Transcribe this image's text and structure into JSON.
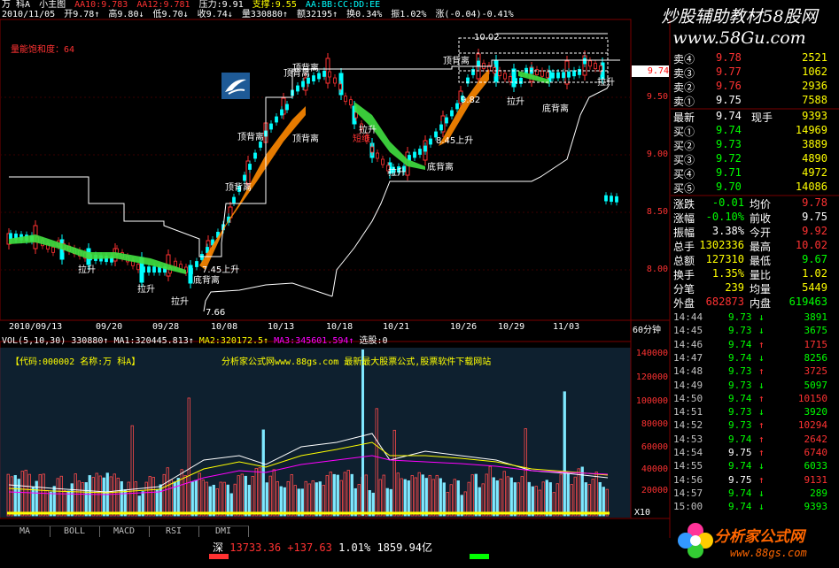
{
  "header": {
    "name": "万  科A",
    "mode": "小主图",
    "aa10": "AA10:9.783",
    "aa12": "AA12:9.781",
    "pressure": "压力:9.91",
    "support": "支撑:9.55",
    "abc": "AA:BB:CC:DD:EE",
    "date": "2010/11/05",
    "open": "开9.78↑",
    "high": "高9.80↓",
    "low": "低9.70↓",
    "close": "收9.74↓",
    "volume": "量330880↑",
    "amount": "额32195↑",
    "turnover": "换0.34%",
    "amplitude": "振1.02%",
    "change": "涨(-0.04)-0.41%"
  },
  "watermark_top": "炒股辅助教材58股网",
  "watermark_top_url": "www.58Gu.com",
  "indicator_label": "量能饱和度：64",
  "annotations": [
    {
      "text": "顶背离",
      "color": "#ffffff"
    },
    {
      "text": "顶背离",
      "color": "#ffffff"
    },
    {
      "text": "顶背离",
      "color": "#ffffff"
    },
    {
      "text": "顶背离",
      "color": "#ffffff"
    },
    {
      "text": "顶背离",
      "color": "#ffffff"
    },
    {
      "text": "顶背离",
      "color": "#ffffff"
    },
    {
      "text": "底背离",
      "color": "#ffffff"
    },
    {
      "text": "底背离",
      "color": "#ffffff"
    },
    {
      "text": "底背离",
      "color": "#ffffff"
    },
    {
      "text": "拉升",
      "color": "#ffffff"
    },
    {
      "text": "拉升",
      "color": "#ffffff"
    },
    {
      "text": "拉升",
      "color": "#ffffff"
    },
    {
      "text": "拉升",
      "color": "#ffffff"
    },
    {
      "text": "拉升",
      "color": "#ffffff"
    },
    {
      "text": "拉升",
      "color": "#ffffff"
    },
    {
      "text": "拉升",
      "color": "#ffffff"
    },
    {
      "text": "短线",
      "color": "#ff3333"
    },
    {
      "text": "7.45上升",
      "color": "#ffffff"
    },
    {
      "text": "8.45上升",
      "color": "#ffffff"
    },
    {
      "text": "7.66",
      "color": "#ffffff"
    },
    {
      "text": "10.02",
      "color": "#ffffff"
    },
    {
      "text": "9.82",
      "color": "#ffffff"
    }
  ],
  "price_axis": [
    "9.50",
    "9.00",
    "8.50",
    "8.00"
  ],
  "price_tag": "9.74",
  "date_axis": [
    "2010/09/13",
    "09/20",
    "09/28",
    "10/08",
    "10/13",
    "10/18",
    "10/21",
    "10/26",
    "10/29",
    "11/03"
  ],
  "period": "60分钟",
  "vol_header": {
    "vol": "VOL(5,10,30) 330880↑",
    "ma1": "MA1:320445.813↑",
    "ma2": "MA2:320172.5↑",
    "ma3": "MA3:345601.594↑",
    "stock_pick": "选股:0"
  },
  "info_panel": {
    "code": "【代码:000002 名称:万  科A】",
    "ad": "分析家公式网www.88gs.com 最新最大股票公式,股票软件下载网站"
  },
  "vol_axis": [
    "140000",
    "120000",
    "100000",
    "80000",
    "60000",
    "40000",
    "20000"
  ],
  "vol_unit": "X10",
  "tabs": [
    "MA",
    "BOLL",
    "MACD",
    "RSI",
    "DMI"
  ],
  "status": {
    "index": "深",
    "value": "13733.36",
    "change": "+137.63",
    "pct": "1.01%",
    "amount": "1859.94亿"
  },
  "watermark_bottom": "分析家公式网",
  "watermark_bottom_url": "www.88gs.com",
  "orderbook": {
    "sells": [
      {
        "label": "卖④",
        "price": "9.78",
        "qty": "2521"
      },
      {
        "label": "卖③",
        "price": "9.77",
        "qty": "1062"
      },
      {
        "label": "卖②",
        "price": "9.76",
        "qty": "2936"
      },
      {
        "label": "卖①",
        "price": "9.75",
        "qty": "7588"
      }
    ],
    "latest": {
      "label": "最新",
      "price": "9.74",
      "label2": "现手",
      "qty": "9393"
    },
    "buys": [
      {
        "label": "买①",
        "price": "9.74",
        "qty": "14969"
      },
      {
        "label": "买②",
        "price": "9.73",
        "qty": "3889"
      },
      {
        "label": "买③",
        "price": "9.72",
        "qty": "4890"
      },
      {
        "label": "买④",
        "price": "9.71",
        "qty": "4972"
      },
      {
        "label": "买⑤",
        "price": "9.70",
        "qty": "14086"
      }
    ]
  },
  "stats": [
    {
      "l1": "涨跌",
      "v1": "-0.01",
      "l2": "均价",
      "v2": "9.78"
    },
    {
      "l1": "涨幅",
      "v1": "-0.10%",
      "l2": "前收",
      "v2": "9.75"
    },
    {
      "l1": "振幅",
      "v1": "3.38%",
      "l2": "今开",
      "v2": "9.92"
    },
    {
      "l1": "总手",
      "v1": "1302336",
      "l2": "最高",
      "v2": "10.02"
    },
    {
      "l1": "总额",
      "v1": "127310",
      "l2": "最低",
      "v2": "9.67"
    },
    {
      "l1": "换手",
      "v1": "1.35%",
      "l2": "量比",
      "v2": "1.02"
    },
    {
      "l1": "分笔",
      "v1": "239",
      "l2": "均量",
      "v2": "5449"
    }
  ],
  "outer_inner": {
    "outer_label": "外盘",
    "outer": "682873",
    "inner_label": "内盘",
    "inner": "619463"
  },
  "ticks": [
    {
      "time": "14:44",
      "price": "9.73",
      "dir": "↓",
      "qty": "3891"
    },
    {
      "time": "14:45",
      "price": "9.73",
      "dir": "↓",
      "qty": "3675"
    },
    {
      "time": "14:46",
      "price": "9.74",
      "dir": "↑",
      "qty": "1715"
    },
    {
      "time": "14:47",
      "price": "9.74",
      "dir": "↓",
      "qty": "8256"
    },
    {
      "time": "14:48",
      "price": "9.73",
      "dir": "↑",
      "qty": "3725"
    },
    {
      "time": "14:49",
      "price": "9.73",
      "dir": "↓",
      "qty": "5097"
    },
    {
      "time": "14:50",
      "price": "9.74",
      "dir": "↑",
      "qty": "10150"
    },
    {
      "time": "14:51",
      "price": "9.73",
      "dir": "↓",
      "qty": "3920"
    },
    {
      "time": "14:52",
      "price": "9.73",
      "dir": "↑",
      "qty": "10294"
    },
    {
      "time": "14:53",
      "price": "9.74",
      "dir": "↑",
      "qty": "2642"
    },
    {
      "time": "14:54",
      "price": "9.75",
      "dir": "↑",
      "qty": "6740"
    },
    {
      "time": "14:55",
      "price": "9.74",
      "dir": "↓",
      "qty": "6033"
    },
    {
      "time": "14:56",
      "price": "9.75",
      "dir": "↑",
      "qty": "9131"
    },
    {
      "time": "14:57",
      "price": "9.74",
      "dir": "↓",
      "qty": "289"
    },
    {
      "time": "15:00",
      "price": "9.74",
      "dir": "↓",
      "qty": "9393"
    }
  ],
  "colors": {
    "up": "#ff3232",
    "down": "#00ffff",
    "yellow": "#ffff00",
    "gold": "#ffc000",
    "white": "#ffffff"
  }
}
